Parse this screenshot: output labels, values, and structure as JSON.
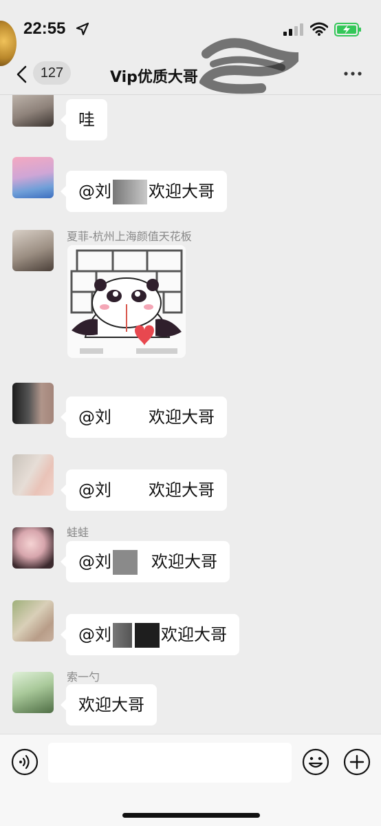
{
  "status_bar": {
    "time": "22:55"
  },
  "nav": {
    "unread_count": "127",
    "title": "Vip优质大哥"
  },
  "messages": [
    {
      "sender": "",
      "text": "哇"
    },
    {
      "sender": "",
      "mention_prefix": "@刘",
      "mention_suffix": "欢迎大哥"
    },
    {
      "sender": "夏菲-杭州上海颜值天花板",
      "type": "sticker"
    },
    {
      "sender": "",
      "mention_prefix": "@刘",
      "mention_suffix": "欢迎大哥"
    },
    {
      "sender": "",
      "mention_prefix": "@刘",
      "mention_suffix": "欢迎大哥"
    },
    {
      "sender": "蛙蛙",
      "mention_prefix": "@刘",
      "mention_suffix": "欢迎大哥"
    },
    {
      "sender": "",
      "mention_prefix": "@刘",
      "mention_suffix": "欢迎大哥"
    },
    {
      "sender": "索一勺",
      "text": "欢迎大哥"
    }
  ],
  "input_bar": {
    "placeholder": ""
  },
  "colors": {
    "background": "#ededed",
    "bubble": "#ffffff",
    "battery_green": "#34c759"
  },
  "icons": [
    "location-arrow-icon",
    "signal-icon",
    "wifi-icon",
    "battery-charging-icon",
    "back-chevron-icon",
    "more-dots-icon",
    "voice-icon",
    "emoji-icon",
    "plus-icon"
  ]
}
